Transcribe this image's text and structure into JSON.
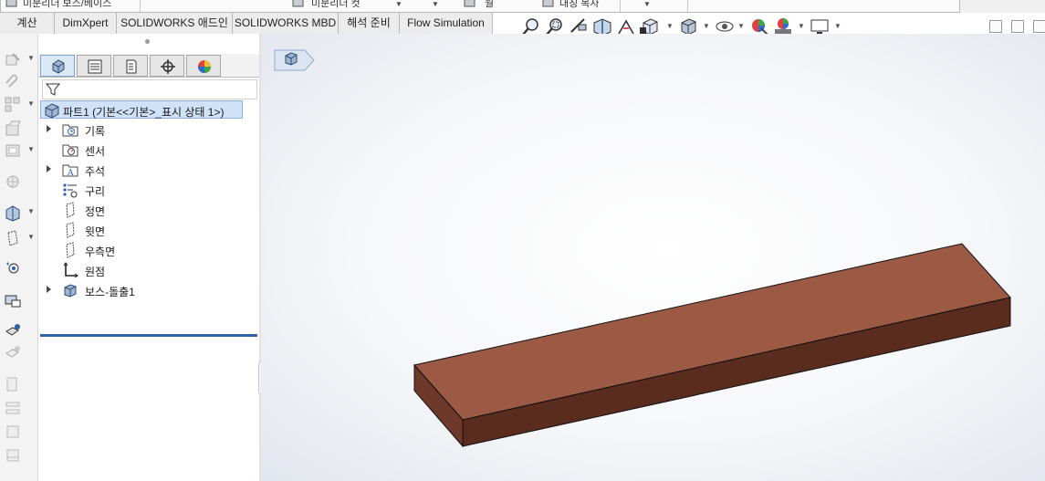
{
  "app": {
    "title": "SOLIDWORKS"
  },
  "ribbon": {
    "partial_labels": [
      "미분리더 보스/베이스",
      "미분리더 컷",
      "월",
      "대칭 복사"
    ]
  },
  "tabs": [
    "계산",
    "DimXpert",
    "SOLIDWORKS 애드인",
    "SOLIDWORKS MBD",
    "해석 준비",
    "Flow Simulation"
  ],
  "feature_tree": {
    "root": "파트1  (기본<<기본>_표시 상태 1>)",
    "items": [
      {
        "label": "기록",
        "icon": "history-folder-icon",
        "expandable": true
      },
      {
        "label": "센서",
        "icon": "sensor-icon",
        "expandable": false
      },
      {
        "label": "주석",
        "icon": "annotations-icon",
        "expandable": true
      },
      {
        "label": "구리",
        "icon": "material-icon",
        "expandable": false
      },
      {
        "label": "정면",
        "icon": "plane-icon",
        "expandable": false
      },
      {
        "label": "윗면",
        "icon": "plane-icon",
        "expandable": false
      },
      {
        "label": "우측면",
        "icon": "plane-icon",
        "expandable": false
      },
      {
        "label": "원점",
        "icon": "origin-icon",
        "expandable": false
      },
      {
        "label": "보스-돌출1",
        "icon": "extrude-feature-icon",
        "expandable": true
      }
    ]
  },
  "colors": {
    "model_top": "#9c5a44",
    "model_front": "#5a2c1e",
    "model_side": "#6e382a",
    "selection": "#cfe2f7",
    "rollback_bar": "#2e63a8"
  }
}
